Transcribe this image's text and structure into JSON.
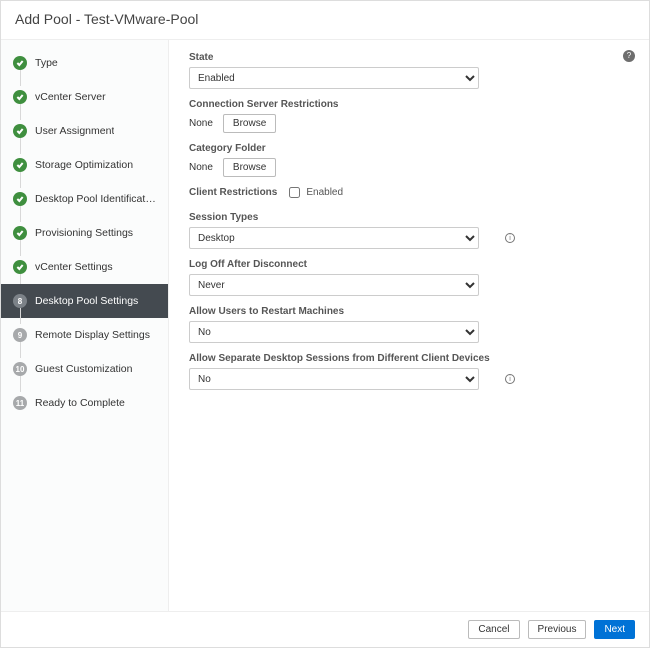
{
  "title": "Add Pool - Test-VMware-Pool",
  "steps": [
    {
      "label": "Type",
      "status": "done"
    },
    {
      "label": "vCenter Server",
      "status": "done"
    },
    {
      "label": "User Assignment",
      "status": "done"
    },
    {
      "label": "Storage Optimization",
      "status": "done"
    },
    {
      "label": "Desktop Pool Identification",
      "status": "done"
    },
    {
      "label": "Provisioning Settings",
      "status": "done"
    },
    {
      "label": "vCenter Settings",
      "status": "done"
    },
    {
      "label": "Desktop Pool Settings",
      "status": "active",
      "num": "8"
    },
    {
      "label": "Remote Display Settings",
      "status": "todo",
      "num": "9"
    },
    {
      "label": "Guest Customization",
      "status": "todo",
      "num": "10"
    },
    {
      "label": "Ready to Complete",
      "status": "todo",
      "num": "11"
    }
  ],
  "form": {
    "state_label": "State",
    "state_value": "Enabled",
    "connection_label": "Connection Server Restrictions",
    "connection_value": "None",
    "browse_label": "Browse",
    "category_label": "Category Folder",
    "category_value": "None",
    "client_restrictions_label": "Client Restrictions",
    "client_restrictions_checkbox_label": "Enabled",
    "session_types_label": "Session Types",
    "session_types_value": "Desktop",
    "logoff_label": "Log Off After Disconnect",
    "logoff_value": "Never",
    "allow_restart_label": "Allow Users to Restart Machines",
    "allow_restart_value": "No",
    "allow_separate_label": "Allow Separate Desktop Sessions from Different Client Devices",
    "allow_separate_value": "No"
  },
  "footer": {
    "cancel": "Cancel",
    "previous": "Previous",
    "next": "Next"
  }
}
